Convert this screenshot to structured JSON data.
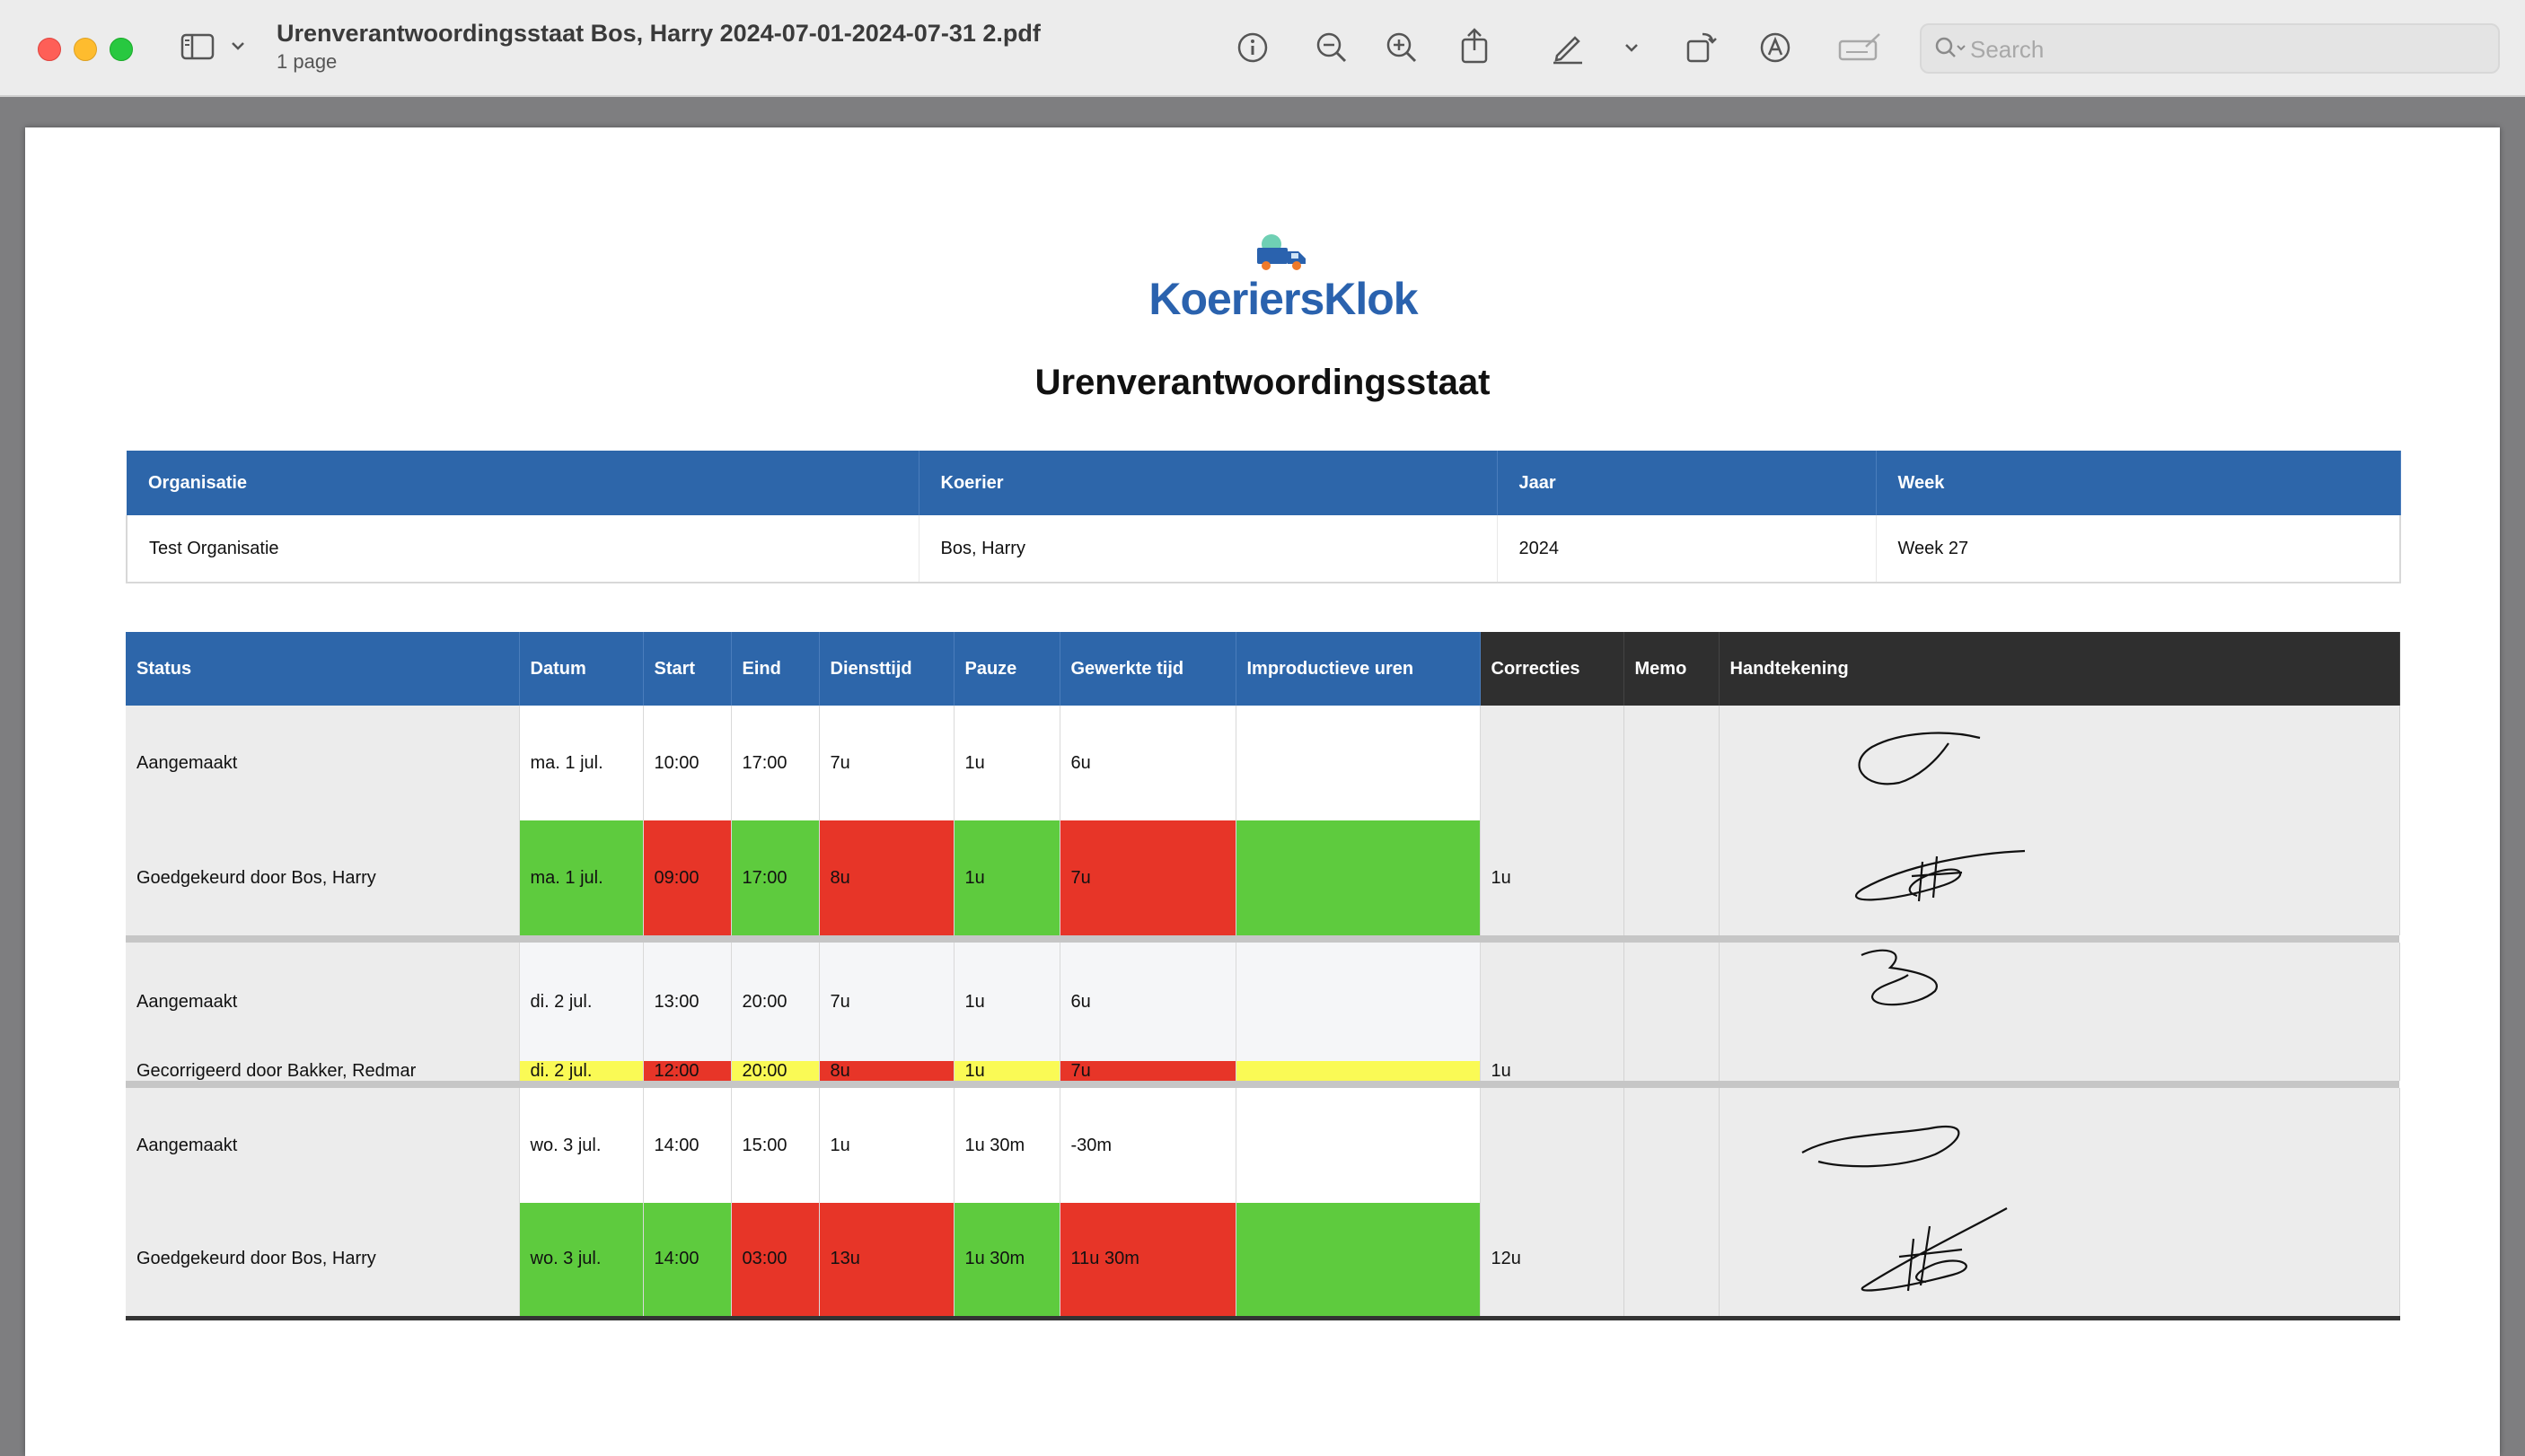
{
  "window": {
    "title": "Urenverantwoordingsstaat Bos, Harry 2024-07-01-2024-07-31 2.pdf",
    "subtitle": "1 page",
    "search": {
      "placeholder": "Search",
      "value": ""
    },
    "toolbar_icons": [
      "sidebar-icon",
      "chevron-down-icon",
      "info-icon",
      "zoom-out-icon",
      "zoom-in-icon",
      "share-icon",
      "markup-pen-icon",
      "chevron-down-icon",
      "rotate-icon",
      "annotate-icon",
      "signature-icon"
    ]
  },
  "document": {
    "logo_text": "KoeriersKlok",
    "heading": "Urenverantwoordingsstaat",
    "info": {
      "headers": [
        "Organisatie",
        "Koerier",
        "Jaar",
        "Week"
      ],
      "values": [
        "Test Organisatie",
        "Bos, Harry",
        "2024",
        "Week 27"
      ]
    },
    "table": {
      "headers": [
        "Status",
        "Datum",
        "Start",
        "Eind",
        "Diensttijd",
        "Pauze",
        "Gewerkte tijd",
        "Improductieve uren",
        "Correcties",
        "Memo",
        "Handtekening"
      ],
      "groups": [
        {
          "rows": [
            {
              "status": "Aangemaakt",
              "datum": "ma. 1 jul.",
              "start": "10:00",
              "eind": "17:00",
              "diensttijd": "7u",
              "pauze": "1u",
              "gewerkte_tijd": "6u",
              "improductieve_uren": "",
              "correcties": "",
              "memo": ""
            },
            {
              "status": "Goedgekeurd door Bos, Harry",
              "datum": "ma. 1 jul.",
              "start": "09:00",
              "eind": "17:00",
              "diensttijd": "8u",
              "pauze": "1u",
              "gewerkte_tijd": "7u",
              "improductieve_uren": "",
              "correcties": "1u",
              "memo": ""
            }
          ]
        },
        {
          "rows": [
            {
              "status": "Aangemaakt",
              "datum": "di. 2 jul.",
              "start": "13:00",
              "eind": "20:00",
              "diensttijd": "7u",
              "pauze": "1u",
              "gewerkte_tijd": "6u",
              "improductieve_uren": "",
              "correcties": "",
              "memo": ""
            },
            {
              "status": "Gecorrigeerd door Bakker, Redmar",
              "datum": "di. 2 jul.",
              "start": "12:00",
              "eind": "20:00",
              "diensttijd": "8u",
              "pauze": "1u",
              "gewerkte_tijd": "7u",
              "improductieve_uren": "",
              "correcties": "1u",
              "memo": ""
            }
          ]
        },
        {
          "rows": [
            {
              "status": "Aangemaakt",
              "datum": "wo. 3 jul.",
              "start": "14:00",
              "eind": "15:00",
              "diensttijd": "1u",
              "pauze": "1u 30m",
              "gewerkte_tijd": "-30m",
              "improductieve_uren": "",
              "correcties": "",
              "memo": ""
            },
            {
              "status": "Goedgekeurd door Bos, Harry",
              "datum": "wo. 3 jul.",
              "start": "14:00",
              "eind": "03:00",
              "diensttijd": "13u",
              "pauze": "1u 30m",
              "gewerkte_tijd": "11u 30m",
              "improductieve_uren": "",
              "correcties": "12u",
              "memo": ""
            }
          ]
        }
      ]
    },
    "colors": {
      "header_blue": "#2d66aa",
      "header_dark": "#2f2f2f",
      "approved_green": "#5ecb3e",
      "changed_red": "#e73528",
      "corrected_yellow": "#fafa55"
    }
  }
}
